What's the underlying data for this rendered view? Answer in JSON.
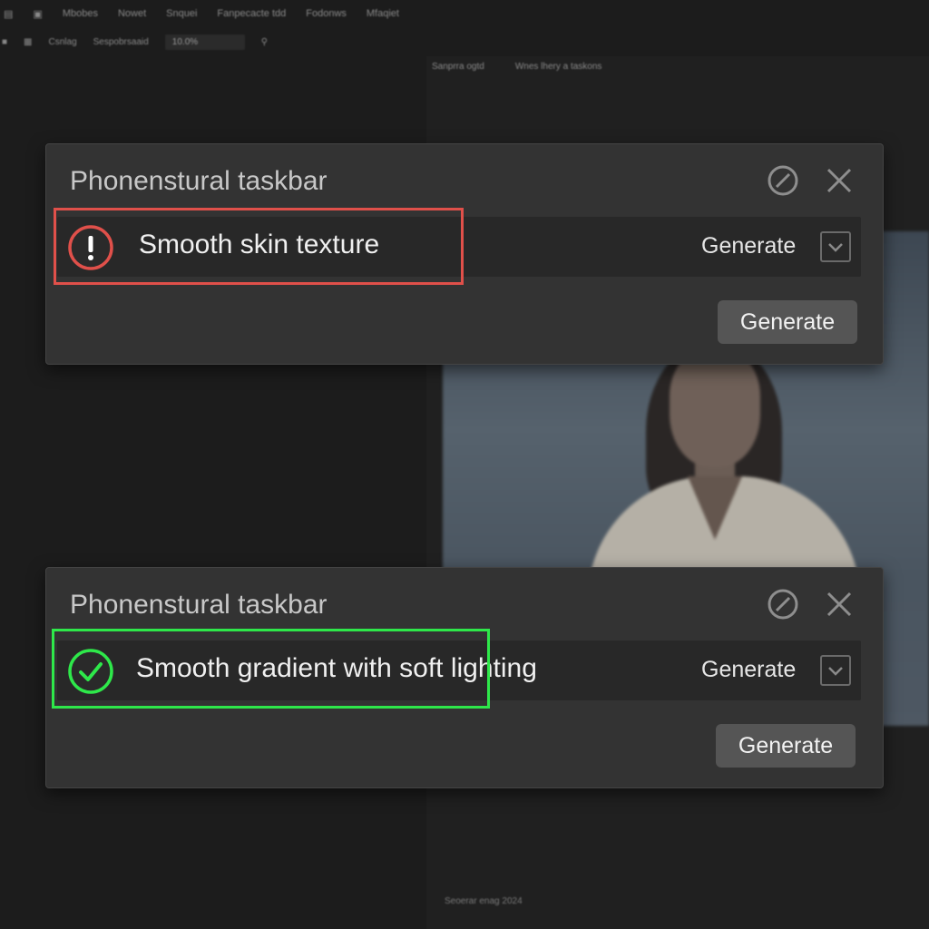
{
  "background_app": {
    "menu": [
      "Mbobes",
      "Nowet",
      "Snquei",
      "Fanpecacte tdd",
      "Fodonws",
      "Mfaqiet"
    ],
    "toolbar": {
      "item1": "Csnlag",
      "item2": "Sespobrsaaid",
      "zoom": "10.0%"
    },
    "canvas_tabs": [
      "Sanprra ogtd",
      "Wnes lhery a taskons"
    ],
    "footer": "Seoerar enag 2024"
  },
  "panels": [
    {
      "title": "Phonenstural taskbar",
      "status": "error",
      "status_icon": "exclamation-icon",
      "prompt": "Smooth skin texture",
      "inline_action": "Generate",
      "button": "Generate"
    },
    {
      "title": "Phonenstural taskbar",
      "status": "success",
      "status_icon": "checkmark-icon",
      "prompt": "Smooth gradient with soft lighting",
      "inline_action": "Generate",
      "button": "Generate"
    }
  ],
  "colors": {
    "error": "#e0504a",
    "success": "#2ee84a",
    "panel_bg": "#333333",
    "button_bg": "#555555"
  }
}
